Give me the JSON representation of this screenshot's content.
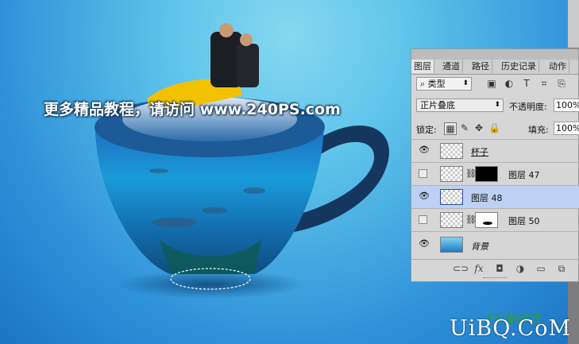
{
  "watermark": {
    "text": "更多精品教程，请访问",
    "site": "www.240PS.com"
  },
  "logo": {
    "brand": "UiBQ.CoM",
    "ps_text": "PS爱好者"
  },
  "panel": {
    "tabs": [
      "图层",
      "通道",
      "路径",
      "历史记录",
      "动作"
    ],
    "filter": {
      "label": "类型"
    },
    "blend_mode": "正片叠底",
    "opacity_label": "不透明度:",
    "opacity_value": "100%",
    "lock_label": "锁定:",
    "fill_label": "填充:",
    "fill_value": "100%",
    "layers": [
      {
        "name": "杯子",
        "visible": true,
        "selected": false,
        "has_mask": false
      },
      {
        "name": "图层 47",
        "visible": false,
        "selected": false,
        "has_mask": true
      },
      {
        "name": "图层 48",
        "visible": true,
        "selected": true,
        "has_mask": false
      },
      {
        "name": "图层 50",
        "visible": false,
        "selected": false,
        "has_mask": true
      },
      {
        "name": "背景",
        "visible": true,
        "selected": false,
        "has_mask": false
      }
    ],
    "bottom_icons": [
      "link-icon",
      "fx-icon",
      "mask-icon",
      "adjustment-icon",
      "folder-icon",
      "new-layer-icon"
    ],
    "fx_label": "fx"
  }
}
